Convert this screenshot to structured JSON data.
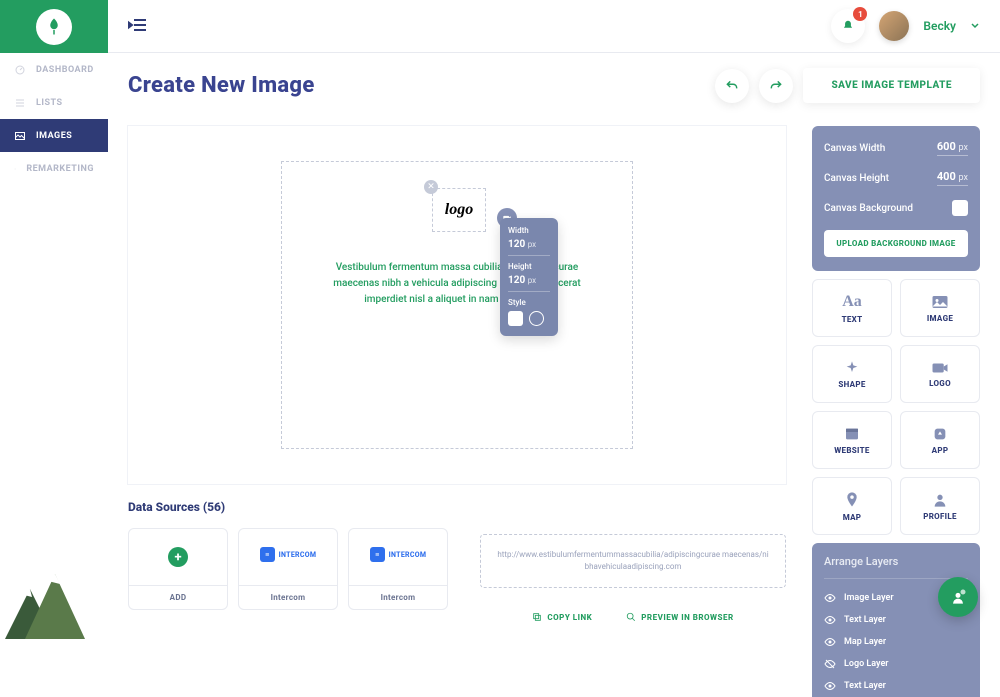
{
  "nav": {
    "items": [
      {
        "label": "DASHBOARD"
      },
      {
        "label": "LISTS"
      },
      {
        "label": "IMAGES"
      },
      {
        "label": "REMARKETING"
      }
    ]
  },
  "topbar": {
    "notifications": "1",
    "user_name": "Becky"
  },
  "header": {
    "title": "Create New Image",
    "save_label": "SAVE IMAGE TEMPLATE"
  },
  "canvas": {
    "logo_text": "logo",
    "placeholder": "Vestibulum fermentum massa cubilia adipiscing curae maecenas nibh a vehicula adipiscing imperdiet placerat imperdiet nisl a aliquet in nam adipiscing."
  },
  "popup": {
    "width_label": "Width",
    "width_value": "120",
    "width_unit": "px",
    "height_label": "Height",
    "height_value": "120",
    "height_unit": "px",
    "style_label": "Style"
  },
  "props": {
    "width_label": "Canvas Width",
    "width_value": "600",
    "width_unit": "px",
    "height_label": "Canvas Height",
    "height_value": "400",
    "height_unit": "px",
    "bg_label": "Canvas Background",
    "upload_label": "UPLOAD BACKGROUND IMAGE"
  },
  "tools": [
    {
      "label": "TEXT"
    },
    {
      "label": "IMAGE"
    },
    {
      "label": "SHAPE"
    },
    {
      "label": "LOGO"
    },
    {
      "label": "WEBSITE"
    },
    {
      "label": "APP"
    },
    {
      "label": "MAP"
    },
    {
      "label": "PROFILE"
    }
  ],
  "layers": {
    "title": "Arrange Layers",
    "items": [
      {
        "label": "Image Layer"
      },
      {
        "label": "Text Layer"
      },
      {
        "label": "Map Layer"
      },
      {
        "label": "Logo Layer"
      },
      {
        "label": "Text Layer"
      }
    ]
  },
  "ds": {
    "title": "Data Sources (56)",
    "add_label": "ADD",
    "intercom_label": "INTERCOM",
    "card_label": "Intercom"
  },
  "url": {
    "text": "http://www.estibulumfermentummassacubilia/adipiscingcurae maecenas/nibhavehiculaadipiscing.com",
    "copy_label": "COPY LINK",
    "preview_label": "PREVIEW IN BROWSER"
  }
}
